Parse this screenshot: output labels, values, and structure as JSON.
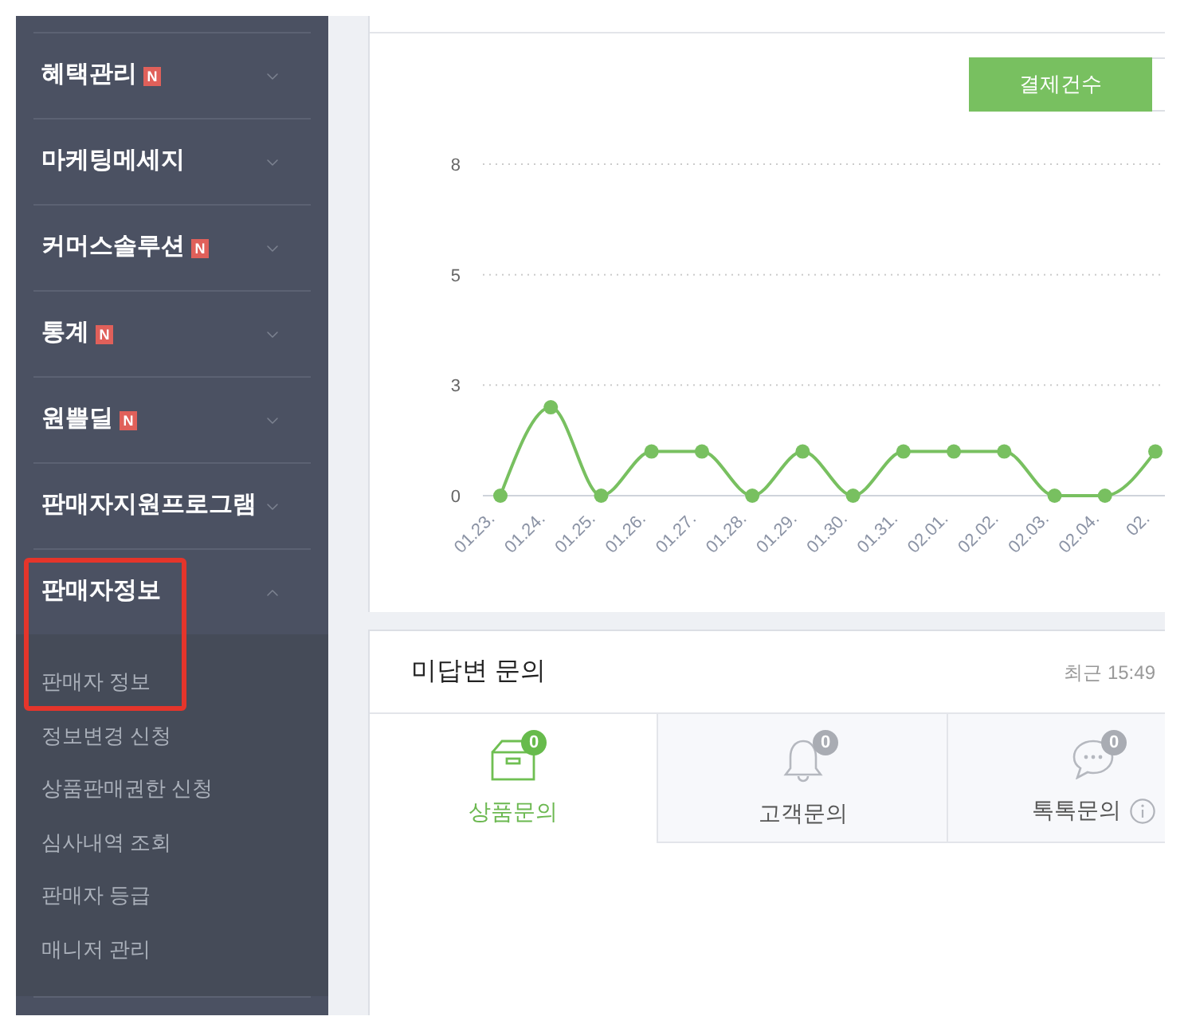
{
  "sidebar": {
    "menu": [
      {
        "label": "혜택관리",
        "badge": "N",
        "expanded": false,
        "highlighted": false
      },
      {
        "label": "마케팅메세지",
        "expanded": false,
        "highlighted": false
      },
      {
        "label": "커머스솔루션",
        "badge": "N",
        "expanded": false,
        "highlighted": false
      },
      {
        "label": "통계",
        "badge": "N",
        "expanded": false,
        "highlighted": false
      },
      {
        "label": "원쁠딜",
        "badge": "N",
        "expanded": false,
        "highlighted": false
      },
      {
        "label": "판매자지원프로그램",
        "expanded": false,
        "highlighted": false
      },
      {
        "label": "판매자정보",
        "expanded": true,
        "highlighted": true,
        "children": [
          {
            "label": "판매자 정보"
          },
          {
            "label": "정보변경 신청"
          },
          {
            "label": "상품판매권한 신청"
          },
          {
            "label": "심사내역 조회"
          },
          {
            "label": "판매자 등급"
          },
          {
            "label": "매니저 관리"
          }
        ]
      }
    ]
  },
  "sales_chart": {
    "second_legend_button": {
      "selected": false
    },
    "chart_data": {
      "type": "line",
      "categories": [
        "01.23.",
        "01.24.",
        "01.25.",
        "01.26.",
        "01.27.",
        "01.28.",
        "01.29.",
        "01.30.",
        "01.31.",
        "02.01.",
        "02.02.",
        "02.03.",
        "02.04.",
        "02."
      ],
      "series": [
        {
          "name": "결제건수",
          "color": "#78c060",
          "marker": "circle",
          "values": [
            0,
            2,
            0,
            1,
            1,
            0,
            1,
            0,
            1,
            1,
            1,
            0,
            0,
            1
          ]
        }
      ],
      "ylim": [
        0,
        7.5
      ],
      "yticks": [
        {
          "value": 0,
          "label": "0"
        },
        {
          "value": 2.5,
          "label": "3"
        },
        {
          "value": 5,
          "label": "5"
        },
        {
          "value": 7.5,
          "label": "8"
        }
      ]
    }
  },
  "unanswered_inquiries": {
    "title": "미답변 문의",
    "updated": "최근 15:49",
    "tabs": [
      {
        "kind": "box",
        "label": "상품문의",
        "count": "0",
        "selected": true,
        "info": false
      },
      {
        "kind": "bell",
        "label": "고객문의",
        "count": "0",
        "selected": false,
        "info": false
      },
      {
        "kind": "chat",
        "label": "톡톡문의",
        "count": "0",
        "selected": false,
        "info": true
      }
    ]
  }
}
